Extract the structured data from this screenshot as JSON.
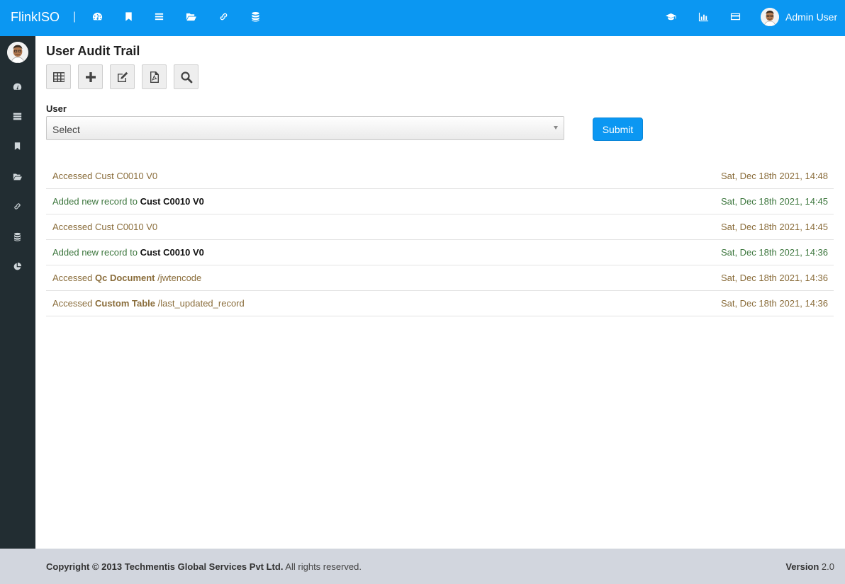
{
  "header": {
    "brand": "FlinkISO",
    "separator": "|",
    "user_name": "Admin User"
  },
  "page": {
    "title": "User Audit Trail"
  },
  "form": {
    "user_label": "User",
    "user_select_value": "Select",
    "submit_label": "Submit"
  },
  "audit": [
    {
      "type": "accessed",
      "prefix": "Accessed Cust C0010 V0",
      "strong": "",
      "suffix": "",
      "timestamp": "Sat, Dec 18th 2021, 14:48"
    },
    {
      "type": "added",
      "prefix": "Added new record to ",
      "strong": "Cust C0010 V0",
      "suffix": "",
      "timestamp": "Sat, Dec 18th 2021, 14:45"
    },
    {
      "type": "accessed",
      "prefix": "Accessed Cust C0010 V0",
      "strong": "",
      "suffix": "",
      "timestamp": "Sat, Dec 18th 2021, 14:45"
    },
    {
      "type": "added",
      "prefix": "Added new record to ",
      "strong": "Cust C0010 V0",
      "suffix": "",
      "timestamp": "Sat, Dec 18th 2021, 14:36"
    },
    {
      "type": "accessed",
      "prefix": "Accessed ",
      "strong": "Qc Document",
      "suffix": " /jwtencode",
      "timestamp": "Sat, Dec 18th 2021, 14:36"
    },
    {
      "type": "accessed",
      "prefix": "Accessed ",
      "strong": "Custom Table",
      "suffix": " /last_updated_record",
      "timestamp": "Sat, Dec 18th 2021, 14:36"
    }
  ],
  "footer": {
    "copyright_prefix": "Copyright © 2013 ",
    "company": "Techmentis Global Services Pvt Ltd.",
    "rights": " All rights reserved.",
    "version_label": "Version",
    "version_value": " 2.0"
  },
  "icons": {
    "topnav": [
      "dashboard-icon",
      "bookmark-icon",
      "list-icon",
      "folder-open-icon",
      "link-icon",
      "database-icon"
    ],
    "topnav_right": [
      "graduation-cap-icon",
      "bar-chart-icon",
      "credit-card-icon"
    ],
    "sidebar": [
      "dashboard-icon",
      "server-icon",
      "bookmark-icon",
      "folder-open-icon",
      "link-icon",
      "database-icon",
      "pie-chart-icon"
    ],
    "toolbar": [
      "table-icon",
      "plus-icon",
      "edit-icon",
      "pdf-icon",
      "search-icon"
    ]
  },
  "colors": {
    "primary": "#0b97f2",
    "sidebar_bg": "#222d32",
    "accessed_text": "#8a6d3b",
    "added_text": "#3c763d",
    "footer_bg": "#d2d6de"
  }
}
